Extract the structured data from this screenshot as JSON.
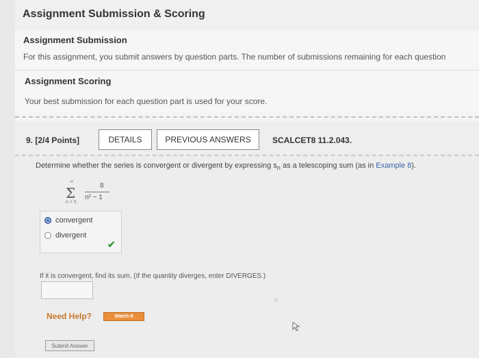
{
  "header": {
    "title": "Assignment Submission & Scoring"
  },
  "submission": {
    "heading": "Assignment Submission",
    "text": "For this assignment, you submit answers by question parts. The number of submissions remaining for each question"
  },
  "scoring": {
    "heading": "Assignment Scoring",
    "text": "Your best submission for each question part is used for your score."
  },
  "question": {
    "number": "9.",
    "points": "[2/4 Points]",
    "details_label": "DETAILS",
    "previous_label": "PREVIOUS ANSWERS",
    "code": "SCALCET8 11.2.043.",
    "prompt_pre": "Determine whether the series is convergent or divergent by expressing s",
    "prompt_sub": "n",
    "prompt_mid": " as a telescoping sum (as in ",
    "prompt_link": "Example 8",
    "prompt_post": ").",
    "series": {
      "upper": "∞",
      "sigma": "Σ",
      "lower": "n = 5",
      "numerator": "8",
      "denominator": "n² − 1"
    },
    "choices": [
      {
        "label": "convergent",
        "selected": true
      },
      {
        "label": "divergent",
        "selected": false
      }
    ],
    "check_symbol": "✔",
    "part2": "If it is convergent, find its sum. (If the quantity diverges, enter DIVERGES.)",
    "answer_value": "",
    "need_help": "Need Help?",
    "watch_label": "Watch It",
    "submit_label": "Submit Answer",
    "faint_mark": "A"
  },
  "colors": {
    "link": "#3a62a8",
    "check": "#3f9a3f",
    "watch": "#e98f3b",
    "need_help": "#c7772b"
  }
}
